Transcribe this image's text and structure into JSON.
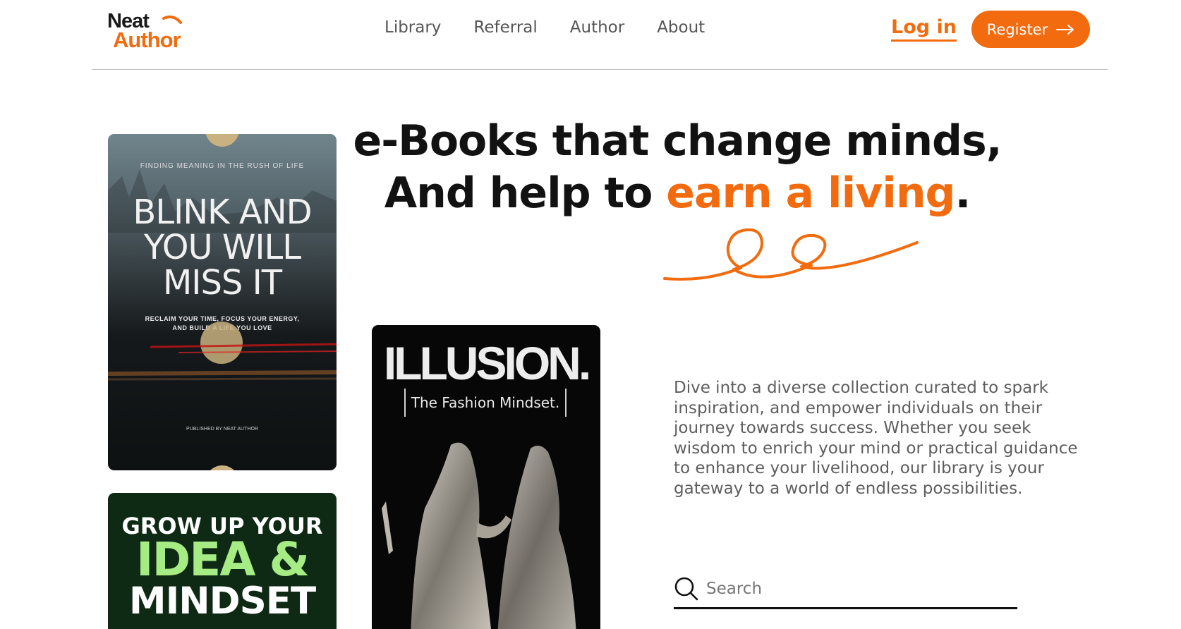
{
  "brand": {
    "logo_line1": "Neat",
    "logo_line2": "Author",
    "accent_color": "#f26b0f"
  },
  "nav": {
    "items": [
      {
        "label": "Library"
      },
      {
        "label": "Referral"
      },
      {
        "label": "Author"
      },
      {
        "label": "About"
      }
    ],
    "login_label": "Log in",
    "register_label": "Register"
  },
  "hero": {
    "line1": "e-Books that change minds,",
    "line2_prefix": "And help to ",
    "line2_accent": "earn a living",
    "line2_suffix": ".",
    "description": "Dive into a diverse collection curated to spark inspiration, and empower individuals on their journey towards success. Whether you seek wisdom to enrich your mind or practical guidance to enhance your livelihood, our library is your gateway to a world of endless possibilities."
  },
  "search": {
    "placeholder": "Search"
  },
  "books": {
    "blink": {
      "kicker": "FINDING MEANING IN THE RUSH OF LIFE",
      "title": "BLINK AND YOU WILL MISS IT",
      "subtitle": "RECLAIM YOUR TIME, FOCUS YOUR ENERGY, AND BUILD A LIFE YOU LOVE",
      "publisher": "PUBLISHED BY NEAT AUTHOR"
    },
    "grow": {
      "line1": "GROW UP YOUR",
      "line2": "IDEA &",
      "line3": "MINDSET"
    },
    "illusion": {
      "title": "ILLUSION.",
      "subtitle": "The Fashion Mindset."
    }
  }
}
